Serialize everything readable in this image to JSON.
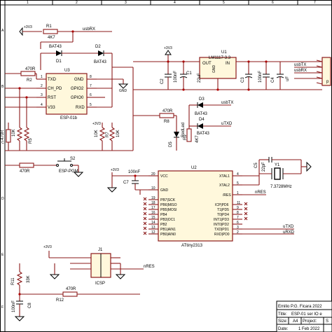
{
  "frame": {
    "top_cols": [
      "1",
      "2",
      "3",
      "4",
      "5",
      "6",
      "7"
    ],
    "side_rows": [
      "A",
      "B",
      "C",
      "D",
      "E",
      "F"
    ]
  },
  "title_block": {
    "author": "Emilio P.G. Ficara 2022",
    "title_label": "Title:",
    "title_value": "ESP-01 ser IO e",
    "size_label": "Size:",
    "size_value": "A4",
    "project_label": "Project:",
    "project_value": "S",
    "date_label": "Date:",
    "date_value": "1 Feb 2022"
  },
  "u3": {
    "ref": "U3",
    "name": "ESP-01b",
    "left_pins": [
      {
        "n": "1",
        "l": "TXD"
      },
      {
        "n": "2",
        "l": "CH_PD"
      },
      {
        "n": "3",
        "l": "RST"
      },
      {
        "n": "4",
        "l": "V33"
      }
    ],
    "right_pins": [
      {
        "n": "8",
        "l": "GND"
      },
      {
        "n": "7",
        "l": "GPIO2"
      },
      {
        "n": "6",
        "l": "GPIO0"
      },
      {
        "n": "5",
        "l": "RXD"
      }
    ]
  },
  "u1": {
    "ref": "U1",
    "name": "LM1117-3.3",
    "out": "OUT",
    "in": "IN",
    "gnd": "GND"
  },
  "u2": {
    "ref": "U2",
    "name": "ATtiny2313",
    "left_pins": [
      {
        "n": "20",
        "l": "VCC"
      },
      {
        "n": "10",
        "l": "GND"
      },
      {
        "n": "19",
        "l": "PB7|SCK"
      },
      {
        "n": "18",
        "l": "PB6|MISO"
      },
      {
        "n": "17",
        "l": "PB5|MOSI"
      },
      {
        "n": "16",
        "l": "PB4"
      },
      {
        "n": "15",
        "l": "PB3|OC1"
      },
      {
        "n": "14",
        "l": "PB2"
      },
      {
        "n": "13",
        "l": "PB1|AIN1"
      },
      {
        "n": "12",
        "l": "PB0|AIN0"
      }
    ],
    "right_pins": [
      {
        "n": "4",
        "l": "XTAL1"
      },
      {
        "n": "5",
        "l": "XTAL2"
      },
      {
        "n": "1",
        "l": "/RES"
      },
      {
        "n": "11",
        "l": "ICP|PD6"
      },
      {
        "n": "9",
        "l": "T1|PD5"
      },
      {
        "n": "8",
        "l": "T0|PD4"
      },
      {
        "n": "7",
        "l": "INT1|PD3"
      },
      {
        "n": "6",
        "l": "INT0|PD2"
      },
      {
        "n": "3",
        "l": "TXD|PD1"
      },
      {
        "n": "2",
        "l": "RXD|PD0"
      }
    ]
  },
  "parts": {
    "r1": {
      "ref": "R1",
      "val": "4K7"
    },
    "r2": {
      "ref": "R2",
      "val": "470R"
    },
    "r3": {
      "ref": "R3",
      "val": "470R"
    },
    "r4": {
      "ref": "R4",
      "val": "10K"
    },
    "r5": {
      "ref": "R5",
      "val": "10K"
    },
    "r6": {
      "ref": "R6",
      "val": "10K"
    },
    "r7": {
      "ref": "R7",
      "val": "10K"
    },
    "r8": {
      "ref": "R8",
      "val": "470R"
    },
    "r9": {
      "ref": "R9",
      "val": "4K7"
    },
    "r11": {
      "ref": "R11",
      "val": "33K"
    },
    "r12": {
      "ref": "R12",
      "val": "470R"
    },
    "r_left": {
      "ref": "R",
      "val": "470R"
    },
    "r_pgm": {
      "ref": "R",
      "val": "470R"
    },
    "c1": {
      "ref": "C1",
      "val": "22uF"
    },
    "c2": {
      "ref": "C2",
      "val": "100nF"
    },
    "c3": {
      "ref": "C3",
      "val": "22uF"
    },
    "c4": {
      "ref": "C4",
      "val": "100nF"
    },
    "c5": {
      "ref": "C5",
      "val": "uF"
    },
    "c6": {
      "ref": "C6",
      "val": "22pF"
    },
    "c7": {
      "ref": "C7",
      "val": "100nF"
    },
    "c8": {
      "ref": "C8",
      "val": "100nF"
    },
    "d1": {
      "ref": "D1",
      "val": "BAT43"
    },
    "d2": {
      "ref": "D2",
      "val": "BAT43"
    },
    "d3": {
      "ref": "D3",
      "val": "BAT43"
    },
    "d4": {
      "ref": "D4",
      "val": "BAT43"
    },
    "d5": {
      "ref": "D5",
      "val": "RedLed"
    },
    "s2": {
      "ref": "S2",
      "val": "ESP-PGM"
    },
    "y1": {
      "ref": "Y1",
      "val": "7.3728MHz"
    },
    "j1": {
      "ref": "J1",
      "val": "ICSP"
    }
  },
  "power": {
    "v33": "+3V3",
    "gnd": "GND"
  },
  "nets": {
    "usbRX": "usbRX",
    "usbTX": "usbTX",
    "uTXD": "uTXD",
    "uRXD": "uRXD",
    "nRES": "nRES",
    "usbTX2": "usbTX",
    "usbRX2": "usbRX"
  },
  "connector_hint": "p"
}
